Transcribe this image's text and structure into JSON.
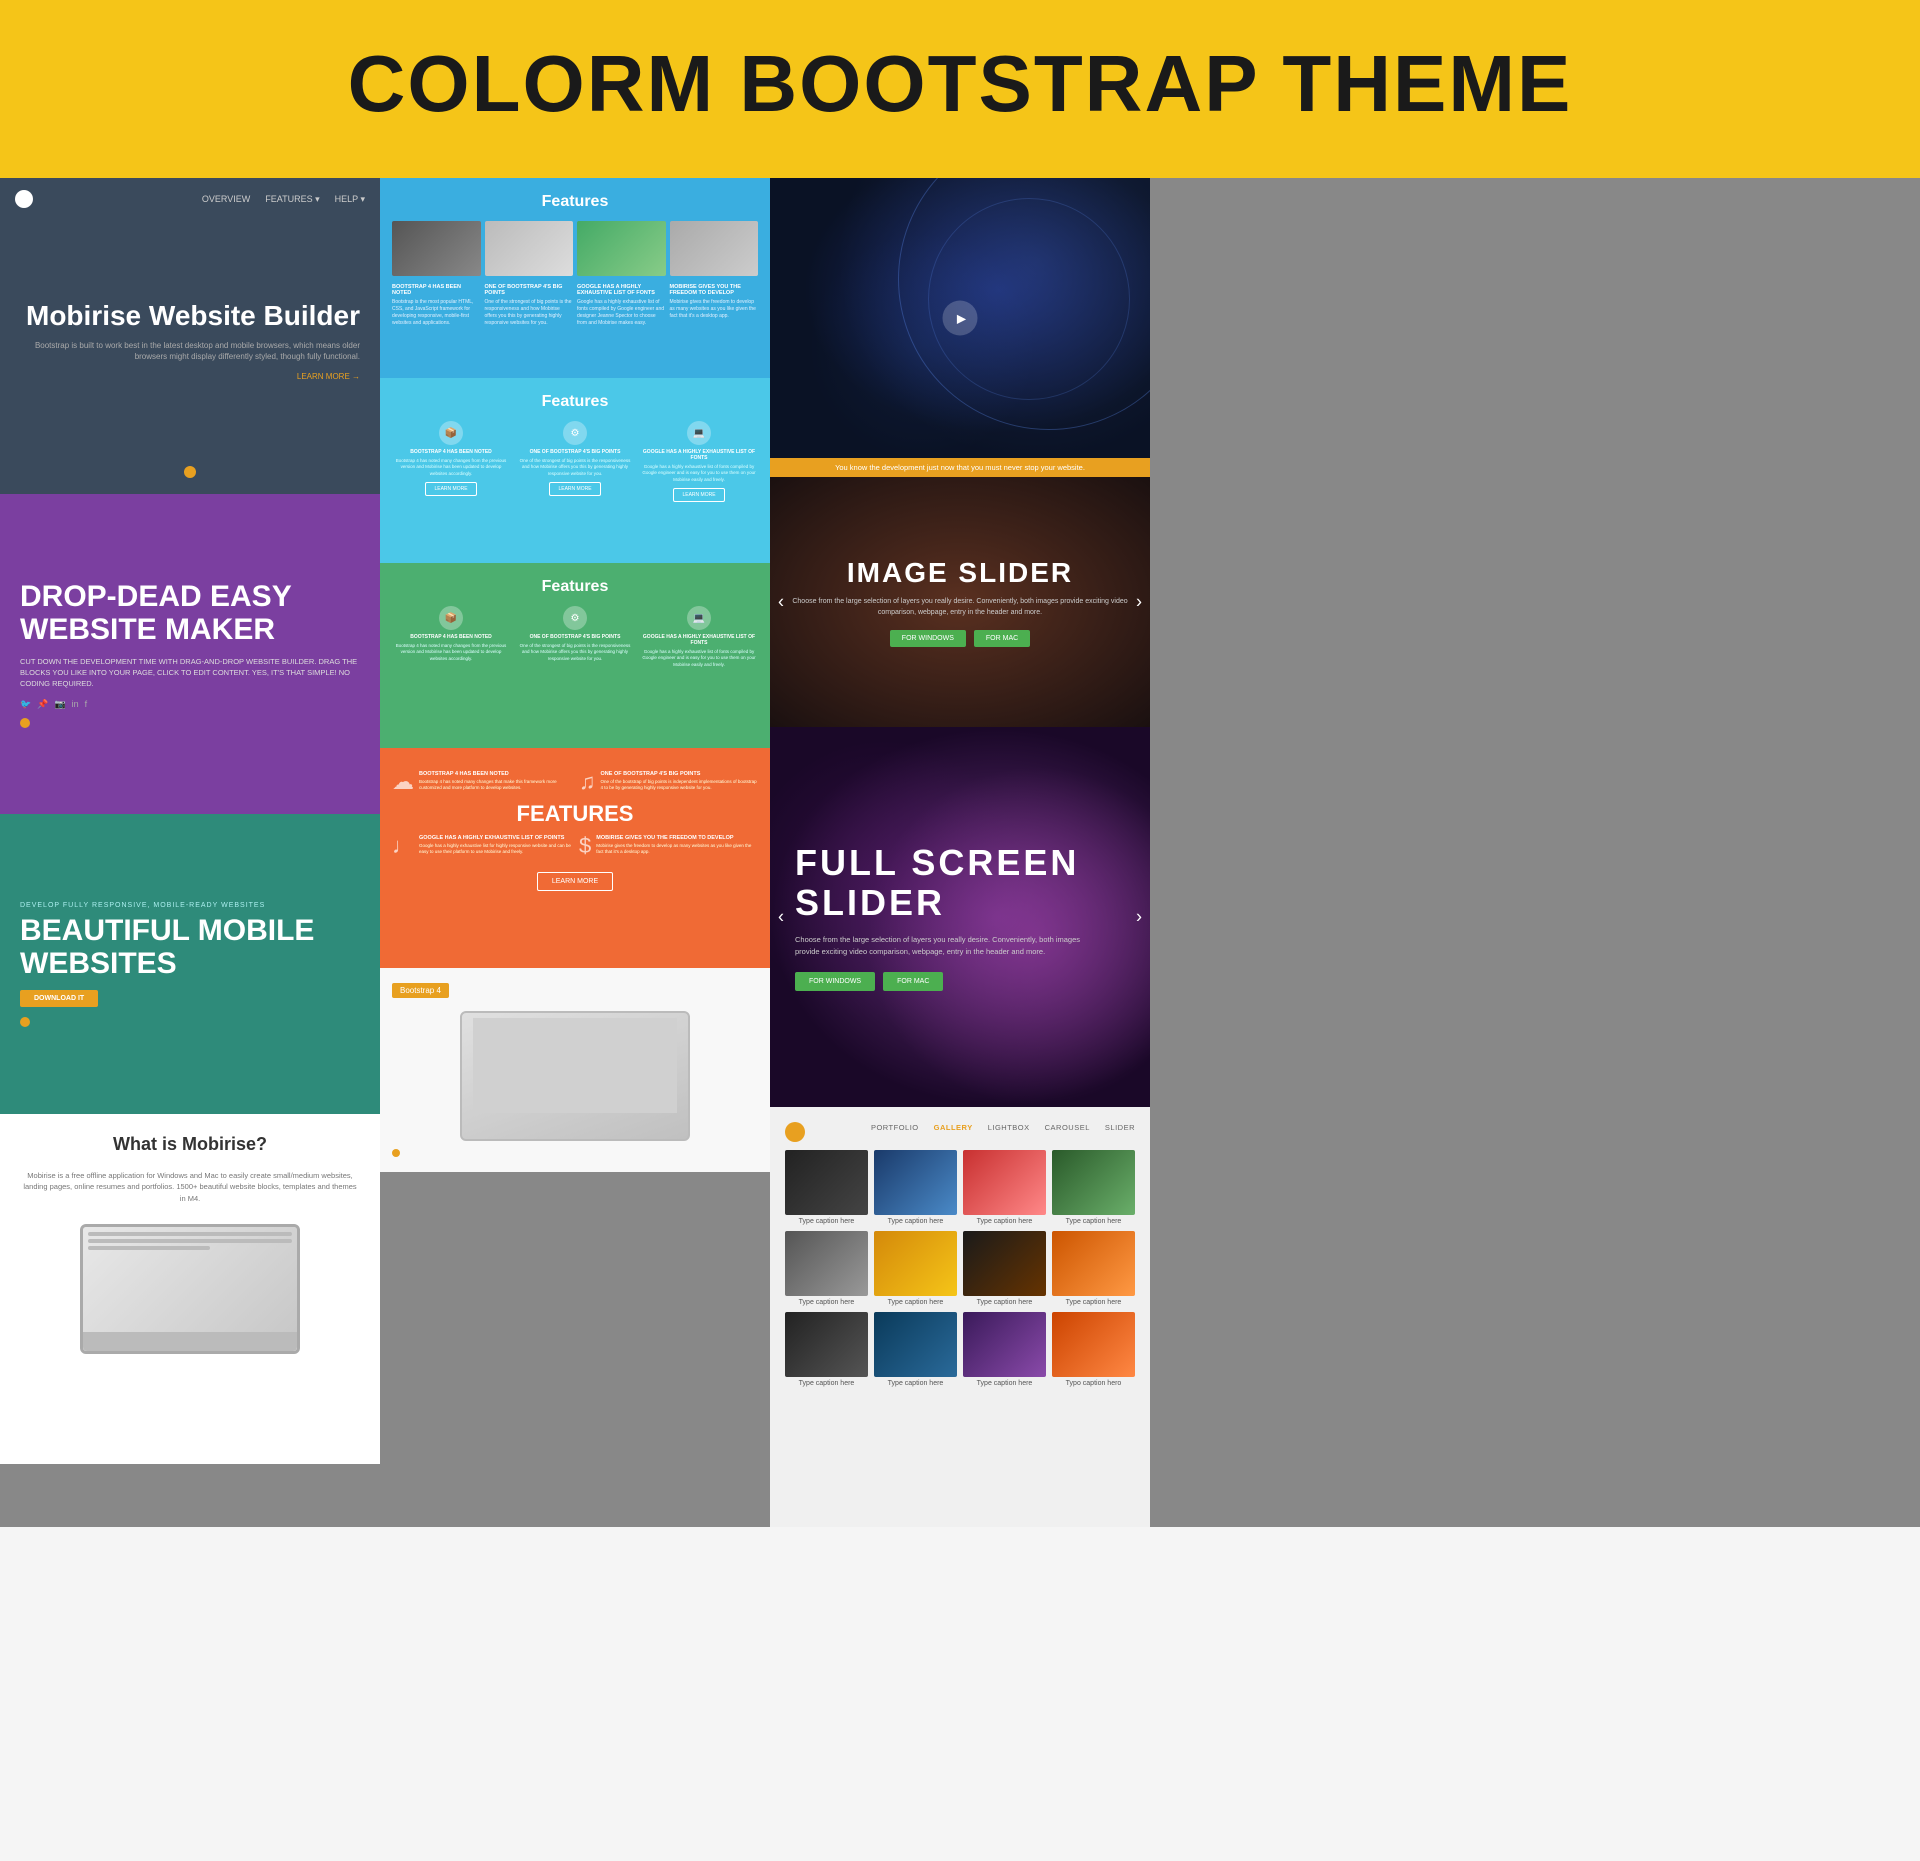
{
  "header": {
    "title": "COLORM BOOTSTRAP THEME",
    "background": "#F5C518"
  },
  "nav": {
    "links": [
      "OVERVIEW",
      "FEATURES ▾",
      "HELP ▾"
    ]
  },
  "panels": {
    "mobirise": {
      "title": "Mobirise Website Builder",
      "description": "Bootstrap is built to work best in the latest desktop and mobile browsers, which means older browsers might display differently styled, though fully functional.",
      "link_text": "LEARN MORE →"
    },
    "purple": {
      "eyebrow": "",
      "title": "DROP-DEAD EASY WEBSITE MAKER",
      "description": "CUT DOWN THE DEVELOPMENT TIME WITH DRAG-AND-DROP WEBSITE BUILDER. DRAG THE BLOCKS YOU LIKE INTO YOUR PAGE, CLICK TO EDIT CONTENT. YES, IT'S THAT SIMPLE! NO CODING REQUIRED."
    },
    "teal": {
      "eyebrow": "DEVELOP FULLY RESPONSIVE, MOBILE-READY WEBSITES",
      "title": "BEAUTIFUL MOBILE WEBSITES",
      "button_label": "DOWNLOAD IT"
    },
    "white": {
      "title": "What is Mobirise?",
      "description": "Mobirise is a free offline application for Windows and Mac to easily create small/medium websites, landing pages, online resumes and portfolios. 1500+ beautiful website blocks, templates and themes in M4."
    }
  },
  "features": {
    "blue": {
      "title": "Features",
      "items": [
        {
          "heading": "BOOTSTRAP 4 HAS BEEN NOTED",
          "text": "Bootstrap is the most popular HTML, CSS, and JavaScript framework for developing responsive, mobile-first websites and applications."
        },
        {
          "heading": "ONE OF BOOTSTRAP 4'S BIG POINTS",
          "text": "One of the strongest of big points is the responsiveness and how Mobirise offers you this by generating highly responsive websites for you."
        },
        {
          "heading": "GOOGLE HAS A HIGHLY EXHAUSTIVE LIST OF FONTS",
          "text": "Google has a highly exhaustive list of fonts compiled by Google engineer and designer Jeanne Spector to choose from and Mobirise makes easy."
        },
        {
          "heading": "MOBIRISE GIVES YOU THE FREEDOM TO DEVELOP",
          "text": "Mobirise gives the freedom to develop as many websites as you like given the fact that it's a desktop app."
        }
      ]
    },
    "lightblue": {
      "title": "Features",
      "items": [
        {
          "heading": "BOOTSTRAP 4 HAS BEEN NOTED",
          "text": "Bootstrap 4 has noted many changes from the previous version and Mobirise has been updated to develop websites accordingly.",
          "btn": "LEARN MORE"
        },
        {
          "heading": "ONE OF BOOTSTRAP 4'S BIG POINTS",
          "text": "One of the strongest of big points is the responsiveness and how Mobirise offers you this by generating highly responsive website for you.",
          "btn": "LEARN MORE"
        },
        {
          "heading": "GOOGLE HAS A HIGHLY EXHAUSTIVE LIST OF FONTS",
          "text": "Google has a highly exhaustive list of fonts compiled by Google engineer and is easy for you to use them on your Mobirise easily and freely.",
          "btn": "LEARN MORE"
        }
      ]
    },
    "green": {
      "title": "Features",
      "items": [
        {
          "heading": "BOOTSTRAP 4 HAS BEEN NOTED",
          "text": "Bootstrap 4 has noted many changes from the previous version and Mobirise has been updated to develop websites accordingly."
        },
        {
          "heading": "ONE OF BOOTSTRAP 4'S BIG POINTS",
          "text": "One of the strongest of big points is the responsiveness and how Mobirise offers you this by generating highly responsive website for you."
        },
        {
          "heading": "GOOGLE HAS A HIGHLY EXHAUSTIVE LIST OF FONTS",
          "text": "Google has a highly exhaustive list of fonts compiled by Google engineer and is easy for you to use them on your Mobirise easily and freely."
        }
      ]
    },
    "orange": {
      "title": "FEATURES",
      "items": [
        {
          "heading": "BOOTSTRAP 4 HAS BEEN NOTED",
          "text": "Bootstrap 4 has noted many changes that make this framework more customized and more platform to develop websites."
        },
        {
          "heading": "ONE OF BOOTSTRAP 4'S BIG POINTS",
          "text": "One of the bootstrap of big points is independent implementations of bootstrap 4 to be by generating highly responsive website for you."
        },
        {
          "heading": "GOOGLE HAS A HIGHLY EXHAUSTIVE LIST OF POINTS",
          "text": "Google has a highly exhaustive list for highly responsive website and can be easy to use their platform to use Mobirise and freely."
        },
        {
          "heading": "MOBIRISE GIVES YOU THE FREEDOM TO DEVELOP",
          "text": "Mobirise gives the freedom to develop as many websites as you like given the fact that it's a desktop app."
        }
      ],
      "btn": "LEARN MORE"
    }
  },
  "slider": {
    "title": "IMAGE SLIDER",
    "description": "Choose from the large selection of layers you really desire. Conveniently, both images provide exciting video comparison, webpage, entry in the header and more.",
    "btn_windows": "FOR WINDOWS",
    "btn_mac": "FOR MAC"
  },
  "fullscreen": {
    "title": "FULL SCREEN SLIDER",
    "description": "Choose from the large selection of layers you really desire. Conveniently, both images provide exciting video comparison, webpage, entry in the header and more.",
    "btn_windows": "FOR WINDOWS",
    "btn_mac": "FOR MAC"
  },
  "gallery": {
    "nav_items": [
      "PORTFOLIO",
      "GALLERY",
      "LIGHTBOX",
      "CAROUSEL",
      "SLIDER"
    ],
    "active_nav": "GALLERY",
    "rows": [
      [
        {
          "caption": "Type caption here",
          "color_class": "g1"
        },
        {
          "caption": "Type caption here",
          "color_class": "g2"
        },
        {
          "caption": "Type caption here",
          "color_class": "g3"
        },
        {
          "caption": "Type caption here",
          "color_class": "g4"
        }
      ],
      [
        {
          "caption": "Type caption here",
          "color_class": "g5"
        },
        {
          "caption": "Type caption here",
          "color_class": "g6"
        },
        {
          "caption": "Type caption here",
          "color_class": "g7"
        },
        {
          "caption": "Type caption here",
          "color_class": "g8"
        }
      ],
      [
        {
          "caption": "Type caption here",
          "color_class": "g9"
        },
        {
          "caption": "Type caption here",
          "color_class": "g10"
        },
        {
          "caption": "Type caption here",
          "color_class": "g11"
        },
        {
          "caption": "Typo caption hero",
          "color_class": "g12"
        }
      ]
    ]
  },
  "bootstrap_badge": "Bootstrap 4",
  "network_bar_text": "You know the development just now that you must never stop your website.",
  "orange_bar_text": "You know the development just now that you must never stop your website."
}
